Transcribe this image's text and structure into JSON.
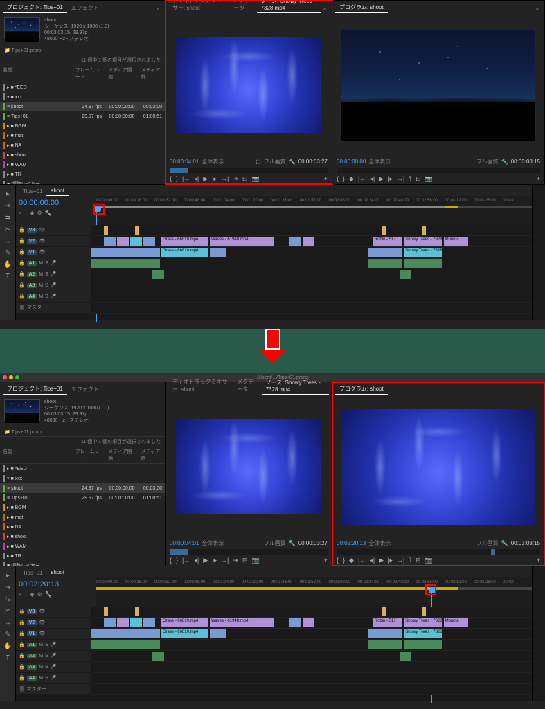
{
  "project": {
    "tab_project": "プロジェクト: Tips+01",
    "tab_effects": "エフェクト",
    "clip_name": "shoot",
    "clip_seq": "シーケンス, 1920 x 1080 (1.0)",
    "clip_dur": "00:03:03:15, 29.97p",
    "clip_audio": "48000 Hz - ステレオ",
    "bin_path": "Tips+01.prproj",
    "status": "11 個中 1 個の項目が選択されました",
    "col_name": "名前",
    "col_fps": "フレームレート",
    "col_start": "メディア開始",
    "col_end": "メディア終",
    "rows": [
      {
        "c": "#888",
        "label": "▸ ■ *EED",
        "fps": "",
        "start": "",
        "end": ""
      },
      {
        "c": "#888",
        "label": " ▾ ■ xxx",
        "fps": "",
        "start": "",
        "end": ""
      },
      {
        "c": "#6a4",
        "label": "  ≡ shoot",
        "fps": "24.97 fps",
        "start": "00:00:00:00",
        "end": "00:03:00",
        "sel": true
      },
      {
        "c": "#6a4",
        "label": "  ≡ Tips+01",
        "fps": "29.97 fps",
        "start": "00:00:00:00",
        "end": "01:00:51"
      },
      {
        "c": "#c90",
        "label": "▸ ■ BGM",
        "fps": "",
        "start": "",
        "end": ""
      },
      {
        "c": "#a70",
        "label": "▸ ■ mat",
        "fps": "",
        "start": "",
        "end": ""
      },
      {
        "c": "#c60",
        "label": "▸ ■ NA",
        "fps": "",
        "start": "",
        "end": ""
      },
      {
        "c": "#c44",
        "label": "▸ ■ shoot",
        "fps": "",
        "start": "",
        "end": ""
      },
      {
        "c": "#a4a",
        "label": "▸ ■ WAM",
        "fps": "",
        "start": "",
        "end": ""
      },
      {
        "c": "#888",
        "label": "▸ ■ TR",
        "fps": "",
        "start": "",
        "end": ""
      },
      {
        "c": "#888",
        "label": "■ 調整レイヤー",
        "fps": "",
        "start": "",
        "end": ""
      }
    ]
  },
  "source": {
    "tab_mixer": "ディオトラックミキサー: shoot",
    "tab_meta": "メタデータ",
    "tab_source": "ソース: Snowy Trees - 7328.mp4",
    "tc_in": "00:00:04:01",
    "fit": "全体表示",
    "full": "フル画質",
    "tc_out": "00:00:03:27"
  },
  "program": {
    "tab": "プログラム: shoot",
    "tc_in_a": "00:00:00:00",
    "tc_in_b": "00:02:20:13",
    "fit": "全体表示",
    "full": "フル画質",
    "tc_out": "00:03:03:15"
  },
  "timeline": {
    "tab_tips": "Tips+01",
    "tab_shoot": "shoot",
    "tc_a": "00:00:00:00",
    "tc_b": "00:02:20:13",
    "ticks": [
      "00:00:00:00",
      "00:00:16:00",
      "00:00:32:00",
      "00:00:48:00",
      "00:01:04:00",
      "00:01:20:00",
      "00:01:36:00",
      "00:01:52:00",
      "00:02:08:00",
      "00:02:24:00",
      "00:02:40:00",
      "00:02:56:00",
      "00:03:12:00",
      "00:03:28:00",
      "00:03:"
    ],
    "tracks_v": [
      "V3",
      "V2",
      "V1"
    ],
    "tracks_a": [
      "A1",
      "A2",
      "A3",
      "A4"
    ],
    "master": "マスター",
    "clips": {
      "grass1": "Grass - 66810.mp4",
      "waves": "Waves - 61948.mp4",
      "robin": "Robin - 517",
      "snowy": "Snowy Trees - 7328",
      "mount": "Mounta",
      "grass2": "Grass - 66810.mp4",
      "snowy2": "Snowy Trees - 7328"
    }
  },
  "titlebar": "/Users/.../Tips+01.prproj"
}
